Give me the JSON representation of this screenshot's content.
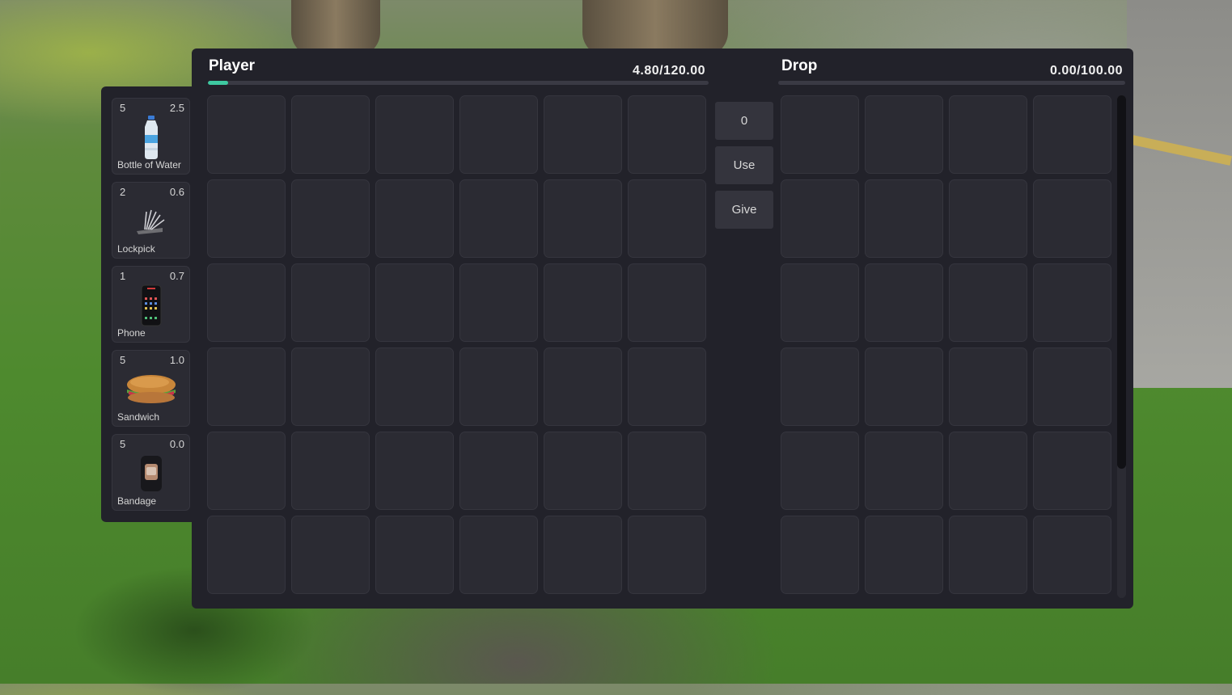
{
  "player": {
    "title": "Player",
    "weight": "4.80/120.00",
    "weight_fraction": 0.04
  },
  "drop": {
    "title": "Drop",
    "weight": "0.00/100.00",
    "weight_fraction": 0.0
  },
  "controls": {
    "amount": "0",
    "use_label": "Use",
    "give_label": "Give"
  },
  "hotbar": [
    {
      "count": "5",
      "weight": "2.5",
      "label": "Bottle of Water",
      "icon": "water-bottle-icon"
    },
    {
      "count": "2",
      "weight": "0.6",
      "label": "Lockpick",
      "icon": "lockpick-icon"
    },
    {
      "count": "1",
      "weight": "0.7",
      "label": "Phone",
      "icon": "phone-icon"
    },
    {
      "count": "5",
      "weight": "1.0",
      "label": "Sandwich",
      "icon": "sandwich-icon"
    },
    {
      "count": "5",
      "weight": "0.0",
      "label": "Bandage",
      "icon": "bandage-icon"
    }
  ],
  "colors": {
    "accent": "#3ec9a1",
    "panel": "#22222a",
    "slot": "#2b2b33"
  }
}
